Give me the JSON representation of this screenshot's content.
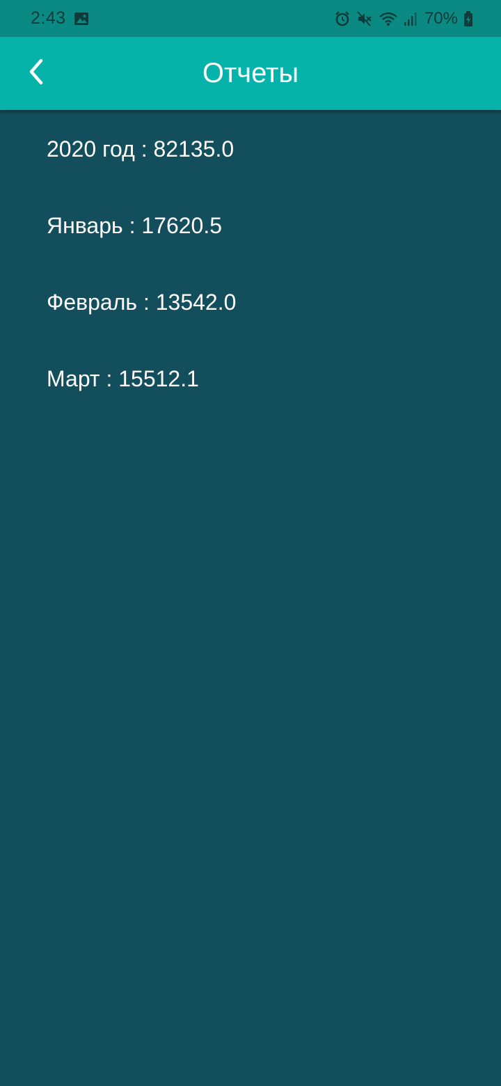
{
  "status_bar": {
    "time": "2:43",
    "battery": "70%",
    "left_icons": [
      "image-icon"
    ],
    "right_icons": [
      "alarm-icon",
      "mute-icon",
      "wifi-icon",
      "signal-icon",
      "battery-icon"
    ]
  },
  "app_bar": {
    "title": "Отчеты",
    "back_icon": "back-chevron-icon"
  },
  "reports": [
    {
      "label": "2020 год : 82135.0"
    },
    {
      "label": "Январь : 17620.5"
    },
    {
      "label": "Февраль : 13542.0"
    },
    {
      "label": "Март : 15512.1"
    }
  ],
  "colors": {
    "status_bar": "#0a8a82",
    "app_bar": "#05b3ab",
    "background": "#134e5c",
    "text": "#ffffff"
  }
}
